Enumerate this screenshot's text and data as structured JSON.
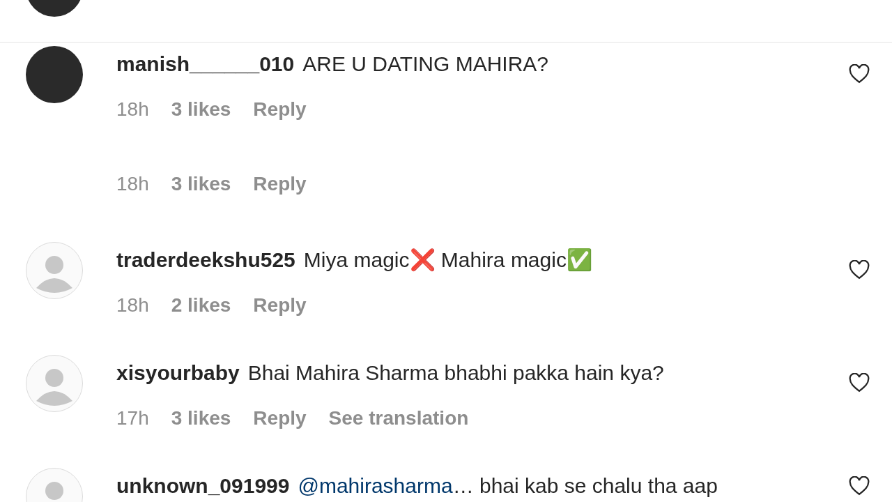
{
  "comments": [
    {
      "kind": "photo_avatar"
    },
    {
      "kind": "photo_avatar",
      "username": "manish______010",
      "text": "ARE U DATING MAHIRA?",
      "time": "18h",
      "likes": "3 likes",
      "reply": "Reply",
      "liked": false
    },
    {
      "kind": "meta_only",
      "time": "18h",
      "likes": "3 likes",
      "reply": "Reply"
    },
    {
      "kind": "default_avatar",
      "username": "traderdeekshu525",
      "text": "Miya magic❌ Mahira magic✅",
      "time": "18h",
      "likes": "2 likes",
      "reply": "Reply",
      "liked": false
    },
    {
      "kind": "default_avatar",
      "username": "xisyourbaby",
      "text": "Bhai Mahira Sharma bhabhi pakka hain kya?",
      "time": "17h",
      "likes": "3 likes",
      "reply": "Reply",
      "translation": "See translation",
      "liked": false
    },
    {
      "kind": "default_avatar",
      "username": "unknown_091999",
      "mention": "@mahirasharma",
      "text": "… bhai kab se chalu tha aap",
      "liked": false
    }
  ]
}
